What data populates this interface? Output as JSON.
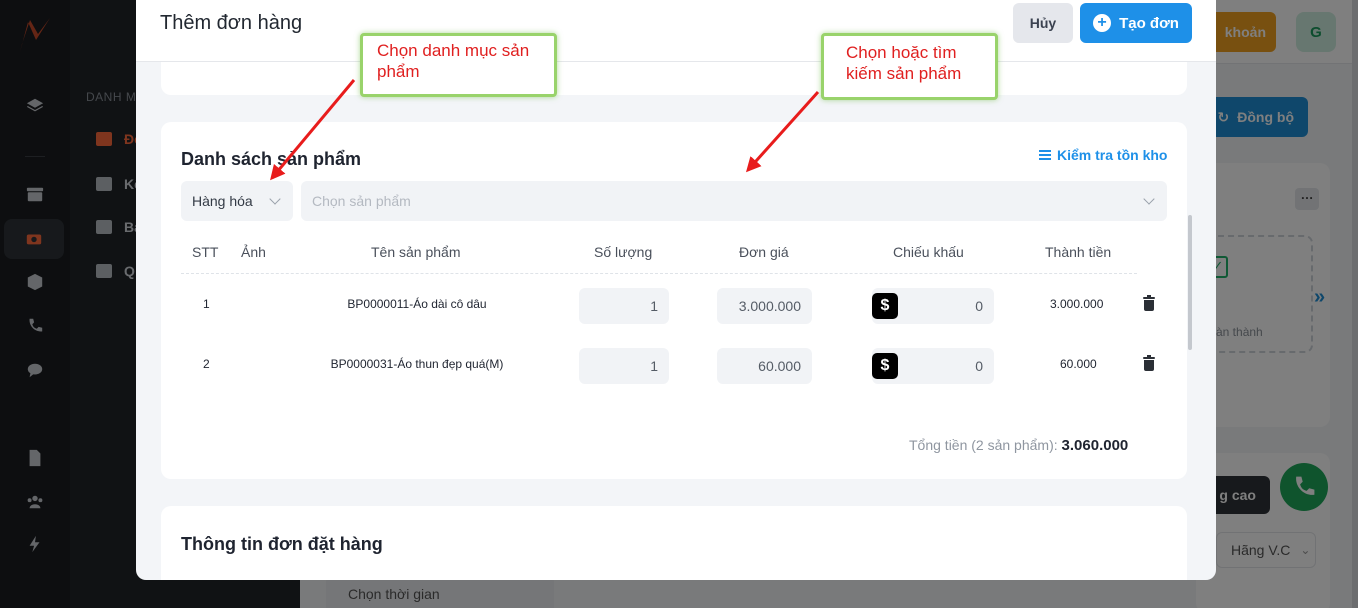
{
  "background": {
    "subnav_section_label": "DANH M",
    "subnav_items": [
      "Đơ",
      "Kê",
      "Bả",
      "Q"
    ],
    "top_button_label": "khoản",
    "avatar_initial": "G",
    "sync_button_label": "Đồng bộ",
    "status_label": "àn thành",
    "dark_button_label": "g cao",
    "carrier_select_label": "Hãng V.C",
    "time_select_label": "Chọn thời gian"
  },
  "modal": {
    "title": "Thêm đơn hàng",
    "cancel_label": "Hủy",
    "create_label": "Tạo đơn",
    "products": {
      "title": "Danh sách sản phẩm",
      "stock_link": "Kiểm tra tồn kho",
      "category_value": "Hàng hóa",
      "product_placeholder": "Chọn sản phẩm",
      "columns": [
        "STT",
        "Ảnh",
        "Tên sản phẩm",
        "Số lượng",
        "Đơn giá",
        "Chiếu khấu",
        "Thành tiền"
      ],
      "rows": [
        {
          "stt": "1",
          "name": "BP0000011-Áo dài cô dâu",
          "qty": "1",
          "price": "3.000.000",
          "discount": "0",
          "amount": "3.000.000"
        },
        {
          "stt": "2",
          "name": "BP0000031-Áo thun đẹp quá(M)",
          "qty": "1",
          "price": "60.000",
          "discount": "0",
          "amount": "60.000"
        }
      ],
      "total_label": "Tổng tiền (2 sản phẩm):",
      "total_value": "3.060.000"
    },
    "order_info_title": "Thông tin đơn đặt hàng"
  },
  "annotations": {
    "category_hint": "Chọn danh mục sản phẩm",
    "product_hint": "Chọn hoặc tìm kiếm sản phẩm"
  },
  "colors": {
    "accent": "#1e90e8",
    "annotation_text": "#e02020",
    "annotation_border": "#99d36b"
  }
}
